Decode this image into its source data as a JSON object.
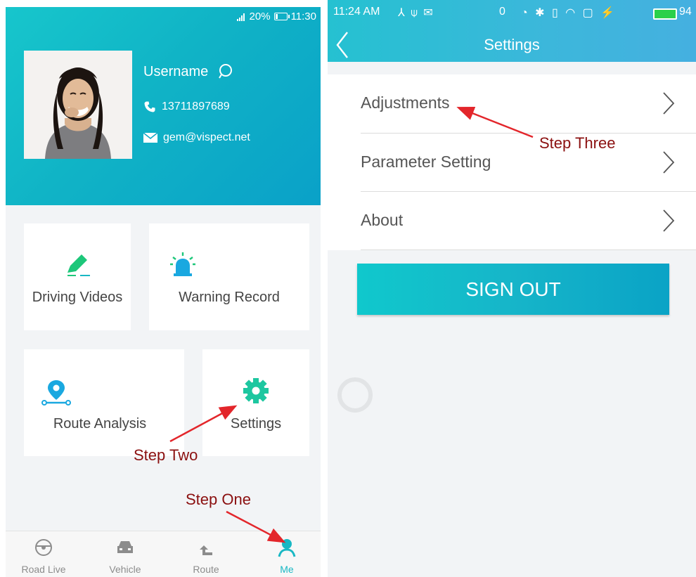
{
  "left_screen": {
    "status_bar": {
      "battery_pct": "20%",
      "time": "11:30"
    },
    "profile": {
      "username": "Username",
      "phone": "13711897689",
      "email": "gem@vispect.net"
    },
    "menu_cards": [
      {
        "label": "Driving Videos",
        "icon": "pencil-icon"
      },
      {
        "label": "Warning Record",
        "icon": "siren-icon"
      },
      {
        "label": "Route Analysis",
        "icon": "route-pin-icon"
      },
      {
        "label": "Settings",
        "icon": "gear-icon"
      }
    ],
    "bottom_nav": [
      {
        "label": "Road Live",
        "icon": "steering-wheel-icon",
        "active": false
      },
      {
        "label": "Vehicle",
        "icon": "car-icon",
        "active": false
      },
      {
        "label": "Route",
        "icon": "route-arrow-icon",
        "active": false
      },
      {
        "label": "Me",
        "icon": "person-icon",
        "active": true
      }
    ]
  },
  "right_screen": {
    "status_bar": {
      "time": "11:24 AM",
      "speed": "0",
      "battery": "94"
    },
    "header": {
      "title": "Settings"
    },
    "settings_items": [
      {
        "label": "Adjustments"
      },
      {
        "label": "Parameter Setting"
      },
      {
        "label": "About"
      }
    ],
    "sign_out_label": "SIGN OUT"
  },
  "annotations": {
    "step_one": "Step One",
    "step_two": "Step Two",
    "step_three": "Step Three",
    "color": "#8b1010",
    "arrow_color": "#e3262b"
  },
  "colors": {
    "accent": "#19b8c4",
    "header_gradient_start": "#17c6cc",
    "header_gradient_end": "#0aa1c8"
  }
}
